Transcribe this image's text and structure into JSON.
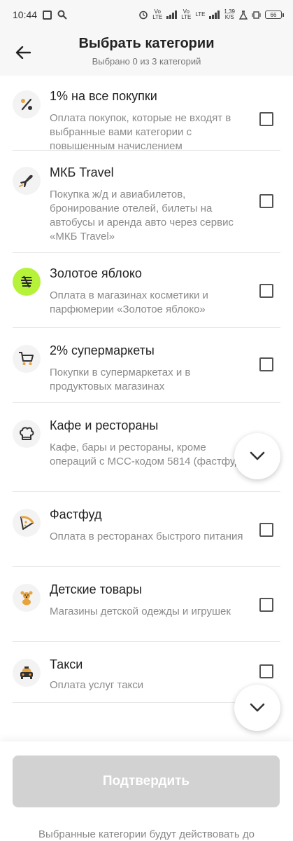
{
  "status_bar": {
    "time": "10:44",
    "volte1": "Vo\nLTE",
    "volte2": "Vo\nLTE",
    "lte": "LTE",
    "speed": "1,39\nK/S",
    "battery": "66"
  },
  "header": {
    "title": "Выбрать категории",
    "subtitle": "Выбрано 0 из 3 категорий"
  },
  "items": [
    {
      "title": "1% на все покупки",
      "desc": "Оплата покупок, которые не входят в выбранные вами категории с повышенным начислением",
      "icon": "percent-icon",
      "checked": false
    },
    {
      "title": "МКБ Travel",
      "desc": "Покупка ж/д и авиабилетов, бронирование отелей, билеты на автобусы и аренда авто через сервис «МКБ Travel»",
      "icon": "airplane-icon",
      "checked": false
    },
    {
      "title": "Золотое яблоко",
      "desc": "Оплата в магазинах косметики и парфюмерии «Золотое яблоко»",
      "icon": "golden-apple-logo-icon",
      "checked": false
    },
    {
      "title": "2% супермаркеты",
      "desc": "Покупки в супермаркетах и в продуктовых магазинах",
      "icon": "shopping-cart-icon",
      "checked": false
    },
    {
      "title": "Кафе и рестораны",
      "desc": "Кафе, бары и рестораны, кроме операций с МСС-кодом 5814 (фастфуд)",
      "icon": "chef-hat-icon",
      "checked": false
    },
    {
      "title": "Фастфуд",
      "desc": "Оплата в ресторанах быстрого питания",
      "icon": "pizza-slice-icon",
      "checked": false
    },
    {
      "title": "Детские товары",
      "desc": "Магазины детской одежды и игрушек",
      "icon": "teddy-bear-icon",
      "checked": false
    },
    {
      "title": "Такси",
      "desc": "Оплата услуг такси",
      "icon": "taxi-icon",
      "checked": false
    }
  ],
  "confirm_label": "Подтвердить",
  "footnote": "Выбранные категории будут действовать до",
  "colors": {
    "accent": "#e8a33d",
    "golden_apple": "#b6f23a",
    "button_disabled": "#d2d2d2"
  }
}
